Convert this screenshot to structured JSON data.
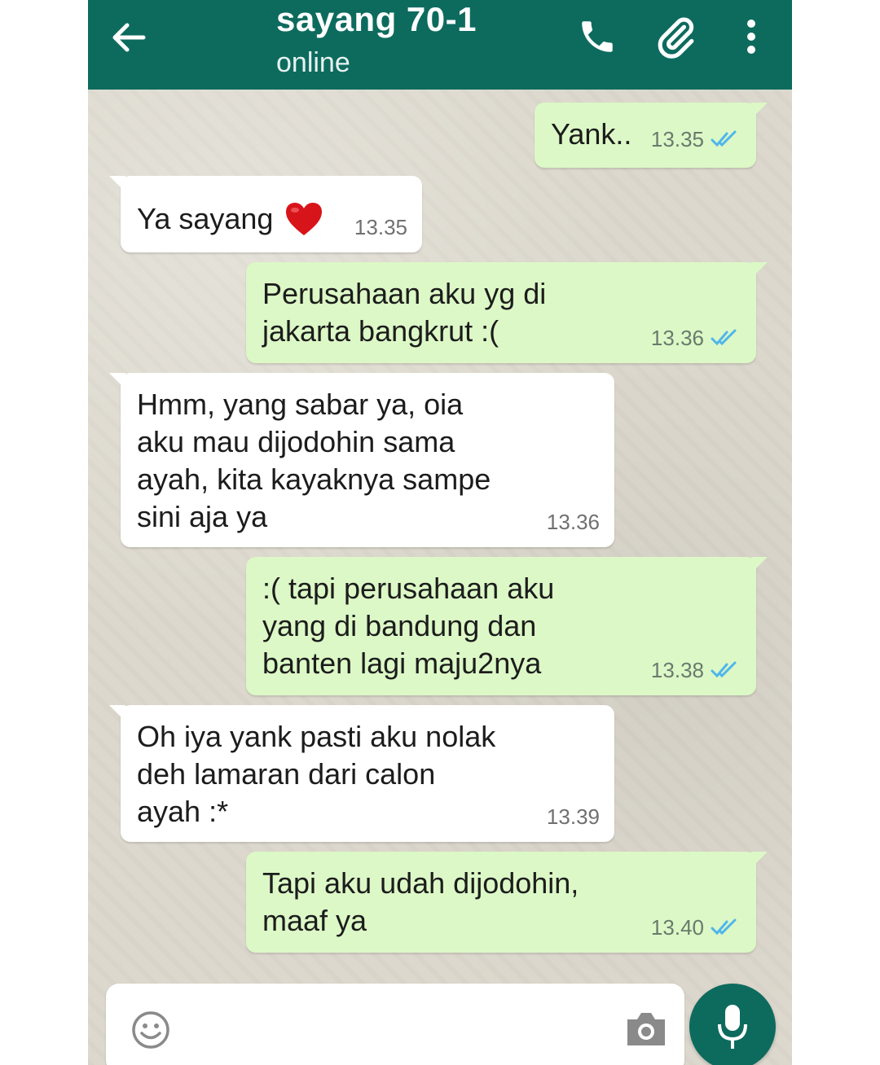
{
  "header": {
    "contact_name": "sayang 70-1",
    "status": "online",
    "icons": [
      "back-arrow-icon",
      "phone-icon",
      "paperclip-icon",
      "more-vert-icon"
    ],
    "color": "#0d6b5e"
  },
  "messages": [
    {
      "direction": "out",
      "text": "Yank..",
      "time": "13.35",
      "read": true
    },
    {
      "direction": "in",
      "text": "Ya sayang",
      "emoji": "heart",
      "time": "13.35"
    },
    {
      "direction": "out",
      "text": "Perusahaan aku yg di\njakarta bangkrut :(",
      "time": "13.36",
      "read": true
    },
    {
      "direction": "in",
      "text": "Hmm, yang sabar ya, oia\naku mau dijodohin sama\nayah, kita kayaknya sampe\nsini aja ya",
      "time": "13.36"
    },
    {
      "direction": "out",
      "text": ":( tapi perusahaan aku\nyang di bandung dan\nbanten lagi maju2nya",
      "time": "13.38",
      "read": true
    },
    {
      "direction": "in",
      "text": "Oh iya yank pasti aku nolak\ndeh lamaran dari calon\nayah :*",
      "time": "13.39"
    },
    {
      "direction": "out",
      "text": "Tapi aku udah dijodohin,\nmaaf ya",
      "time": "13.40",
      "read": true
    }
  ],
  "composer": {
    "placeholder": "",
    "icons": [
      "emoji-icon",
      "camera-icon",
      "microphone-icon"
    ]
  },
  "colors": {
    "outgoing_bubble": "#dcf8c6",
    "incoming_bubble": "#ffffff",
    "read_tick": "#4fb6ec"
  }
}
